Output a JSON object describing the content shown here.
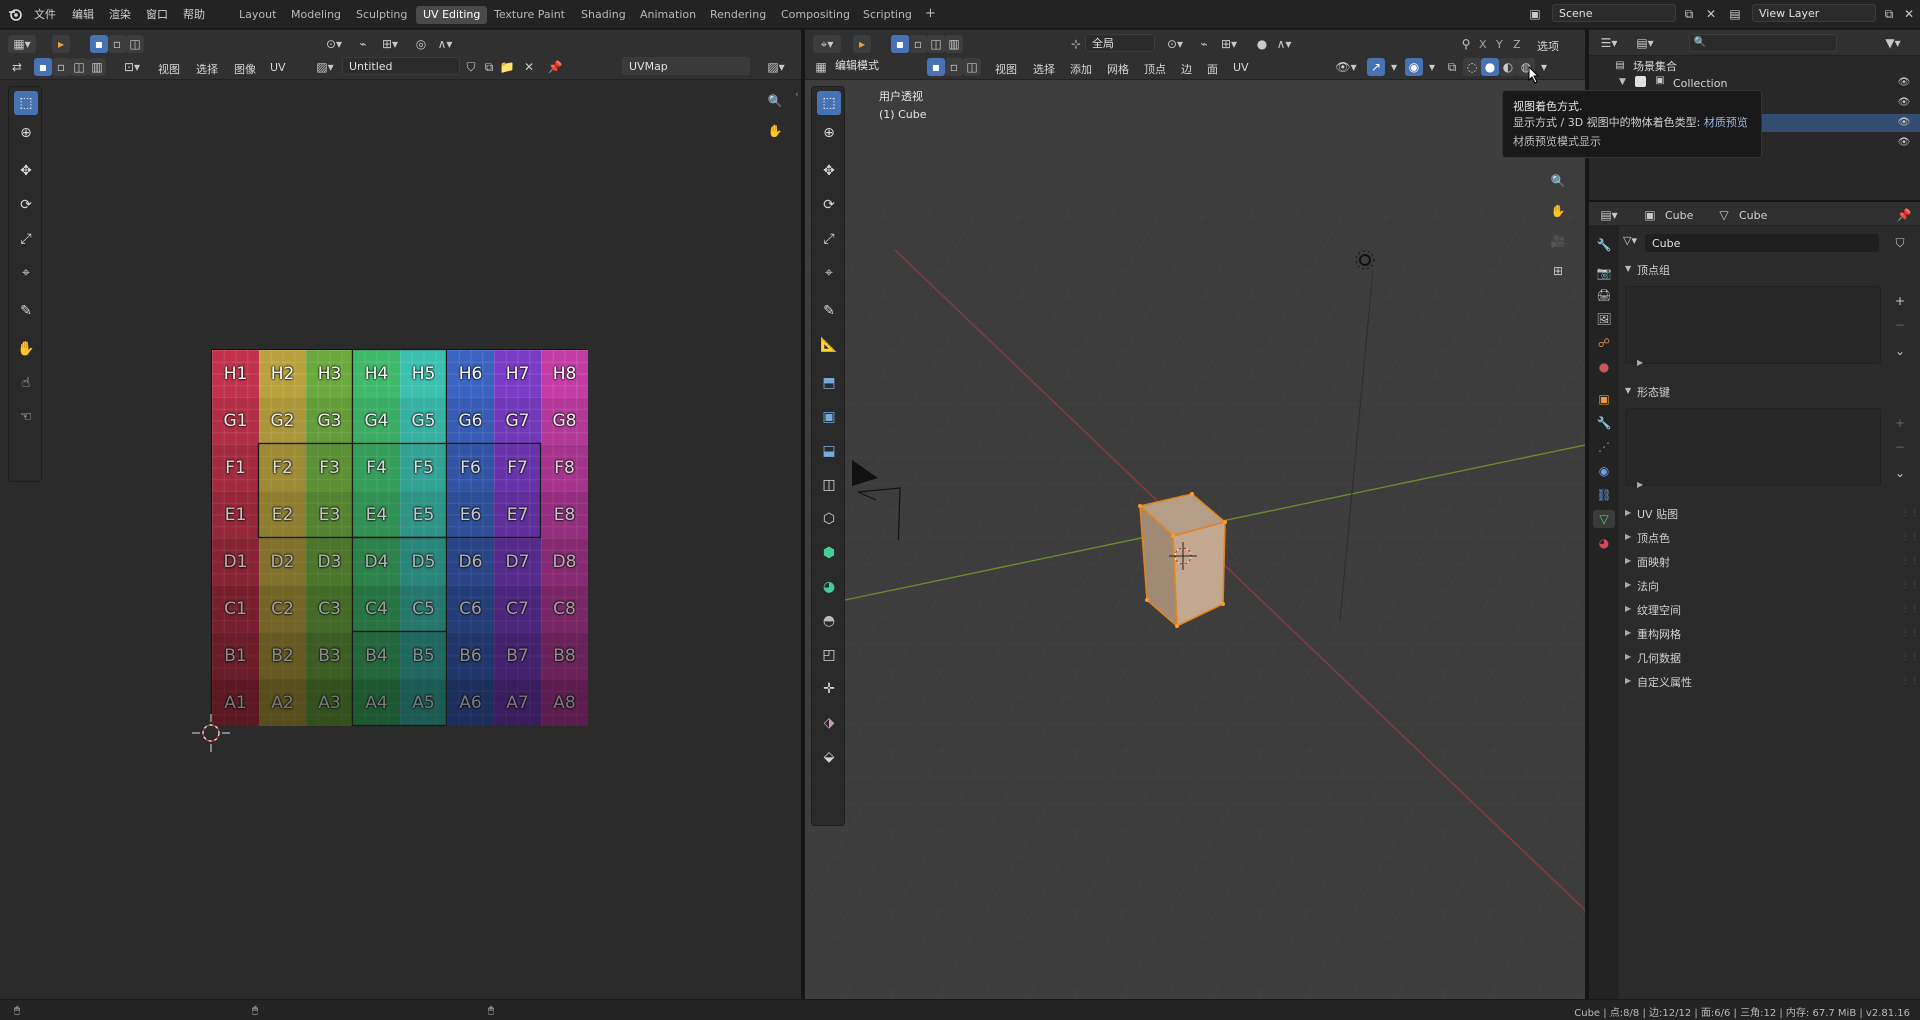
{
  "top_menu": {
    "logo": "blender-logo-icon",
    "items": [
      "文件",
      "编辑",
      "渲染",
      "窗口",
      "帮助"
    ]
  },
  "workspaces": {
    "tabs": [
      "Layout",
      "Modeling",
      "Sculpting",
      "UV Editing",
      "Texture Paint",
      "Shading",
      "Animation",
      "Rendering",
      "Compositing",
      "Scripting"
    ],
    "active": "UV Editing",
    "add": "+"
  },
  "scene": {
    "name": "Scene",
    "view_layer": "View Layer"
  },
  "uv_editor": {
    "menus": [
      "视图",
      "选择",
      "图像",
      "UV"
    ],
    "image_name": "Untitled",
    "uvmap_name": "UVMap",
    "grid_rows": [
      [
        "H1",
        "H2",
        "H3",
        "H4",
        "H5",
        "H6",
        "H7",
        "H8"
      ],
      [
        "G1",
        "G2",
        "G3",
        "G4",
        "G5",
        "G6",
        "G7",
        "G8"
      ],
      [
        "F1",
        "F2",
        "F3",
        "F4",
        "F5",
        "F6",
        "F7",
        "F8"
      ],
      [
        "E1",
        "E2",
        "E3",
        "E4",
        "E5",
        "E6",
        "E7",
        "E8"
      ],
      [
        "D1",
        "D2",
        "D3",
        "D4",
        "D5",
        "D6",
        "D7",
        "D8"
      ],
      [
        "C1",
        "C2",
        "C3",
        "C4",
        "C5",
        "C6",
        "C7",
        "C8"
      ],
      [
        "B1",
        "B2",
        "B3",
        "B4",
        "B5",
        "B6",
        "B7",
        "B8"
      ],
      [
        "A1",
        "A2",
        "A3",
        "A4",
        "A5",
        "A6",
        "A7",
        "A8"
      ]
    ],
    "column_colors": [
      "#c0324a",
      "#b9a23e",
      "#6ba93e",
      "#3fba6b",
      "#3bbfae",
      "#3a63c2",
      "#7a3cc7",
      "#c23ca4"
    ]
  },
  "viewport": {
    "mode": "编辑模式",
    "transform_orientation": "全局",
    "menus": [
      "视图",
      "选择",
      "添加",
      "网格",
      "顶点",
      "边",
      "面",
      "UV"
    ],
    "axes": [
      "X",
      "Y",
      "Z"
    ],
    "options_label": "选项",
    "view_name": "用户透视",
    "object_label": "(1) Cube"
  },
  "tooltip": {
    "line1": "视图着色方式.",
    "line2_prefix": "显示方式 / 3D 视图中的物体着色类型:",
    "line2_value": "材质预览",
    "line3": "材质预览模式显示"
  },
  "outliner": {
    "search_placeholder": "",
    "scene_collection": "场景集合",
    "collection": "Collection"
  },
  "properties": {
    "object_name": "Cube",
    "mesh_name": "Cube",
    "datablock_name": "Cube",
    "sections_open": [
      "顶点组",
      "形态键"
    ],
    "sections_closed": [
      "UV 贴图",
      "顶点色",
      "面映射",
      "法向",
      "纹理空间",
      "重构网格",
      "几何数据",
      "自定义属性"
    ]
  },
  "status": {
    "text": "Cube | 点:8/8 | 边:12/12 | 面:6/6 | 三角:12 | 内存: 67.7 MiB | v2.81.16"
  }
}
